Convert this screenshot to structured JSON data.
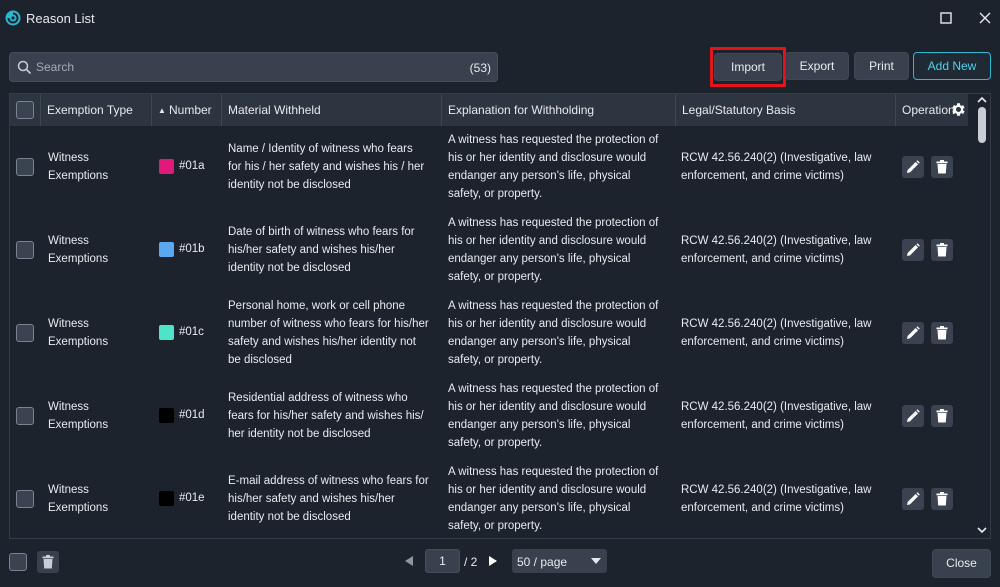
{
  "window": {
    "title": "Reason List"
  },
  "search": {
    "placeholder": "Search",
    "count": "(53)"
  },
  "toolbar": {
    "import_label": "Import",
    "export_label": "Export",
    "print_label": "Print",
    "add_new_label": "Add New"
  },
  "columns": [
    "Exemption Type",
    "Number",
    "Material Withheld",
    "Explanation for Withholding",
    "Legal/Statutory Basis",
    "Operation"
  ],
  "rows": [
    {
      "type_line1": "Witness",
      "type_line2": "Exemptions",
      "color": "#e0197a",
      "number": "#01a",
      "material": [
        "Name / Identity of witness who fears",
        "for his / her safety and wishes his / her",
        "identity not be disclosed"
      ],
      "explanation": [
        "A witness has requested the protection of",
        "his or her identity and disclosure would",
        "endanger any person's life, physical",
        "safety, or property."
      ],
      "basis": [
        "RCW 42.56.240(2) (Investigative, law",
        "enforcement, and crime victims)"
      ]
    },
    {
      "type_line1": "Witness",
      "type_line2": "Exemptions",
      "color": "#5aa8f0",
      "number": "#01b",
      "material": [
        "Date of birth of witness who fears for",
        "his/her safety and wishes his/her",
        "identity not be disclosed"
      ],
      "explanation": [
        "A witness has requested the protection of",
        "his or her identity and disclosure would",
        "endanger any person's life, physical",
        "safety, or property."
      ],
      "basis": [
        "RCW 42.56.240(2) (Investigative, law",
        "enforcement, and crime victims)"
      ]
    },
    {
      "type_line1": "Witness",
      "type_line2": "Exemptions",
      "color": "#4fe3c8",
      "number": "#01c",
      "material": [
        "Personal home, work or cell phone",
        "number of witness who fears for his/her",
        "safety and wishes his/her identity not",
        "be disclosed"
      ],
      "explanation": [
        "A witness has requested the protection of",
        "his or her identity and disclosure would",
        "endanger any person's life, physical",
        "safety, or property."
      ],
      "basis": [
        "RCW 42.56.240(2) (Investigative, law",
        "enforcement, and crime victims)"
      ]
    },
    {
      "type_line1": "Witness",
      "type_line2": "Exemptions",
      "color": "#000000",
      "number": "#01d",
      "material": [
        "Residential address of witness who",
        "fears for his/her safety and wishes his/",
        "her identity not be disclosed"
      ],
      "explanation": [
        "A witness has requested the protection of",
        "his or her identity and disclosure would",
        "endanger any person's life, physical",
        "safety, or property."
      ],
      "basis": [
        "RCW 42.56.240(2) (Investigative, law",
        "enforcement, and crime victims)"
      ]
    },
    {
      "type_line1": "Witness",
      "type_line2": "Exemptions",
      "color": "#000000",
      "number": "#01e",
      "material": [
        "E-mail address of witness who fears for",
        "his/her safety and wishes his/her",
        "identity not be disclosed"
      ],
      "explanation": [
        "A witness has requested the protection of",
        "his or her identity and disclosure would",
        "endanger any person's life, physical",
        "safety, or property."
      ],
      "basis": [
        "RCW 42.56.240(2) (Investigative, law",
        "enforcement, and crime victims)"
      ]
    }
  ],
  "pagination": {
    "current_page": "1",
    "total_label": "/ 2",
    "per_page": "50 / page"
  },
  "footer": {
    "close_label": "Close"
  },
  "colors": {
    "accent": "#2ab8d3",
    "highlight": "#e3151b",
    "background": "#1c232d",
    "header": "#2d3540"
  }
}
